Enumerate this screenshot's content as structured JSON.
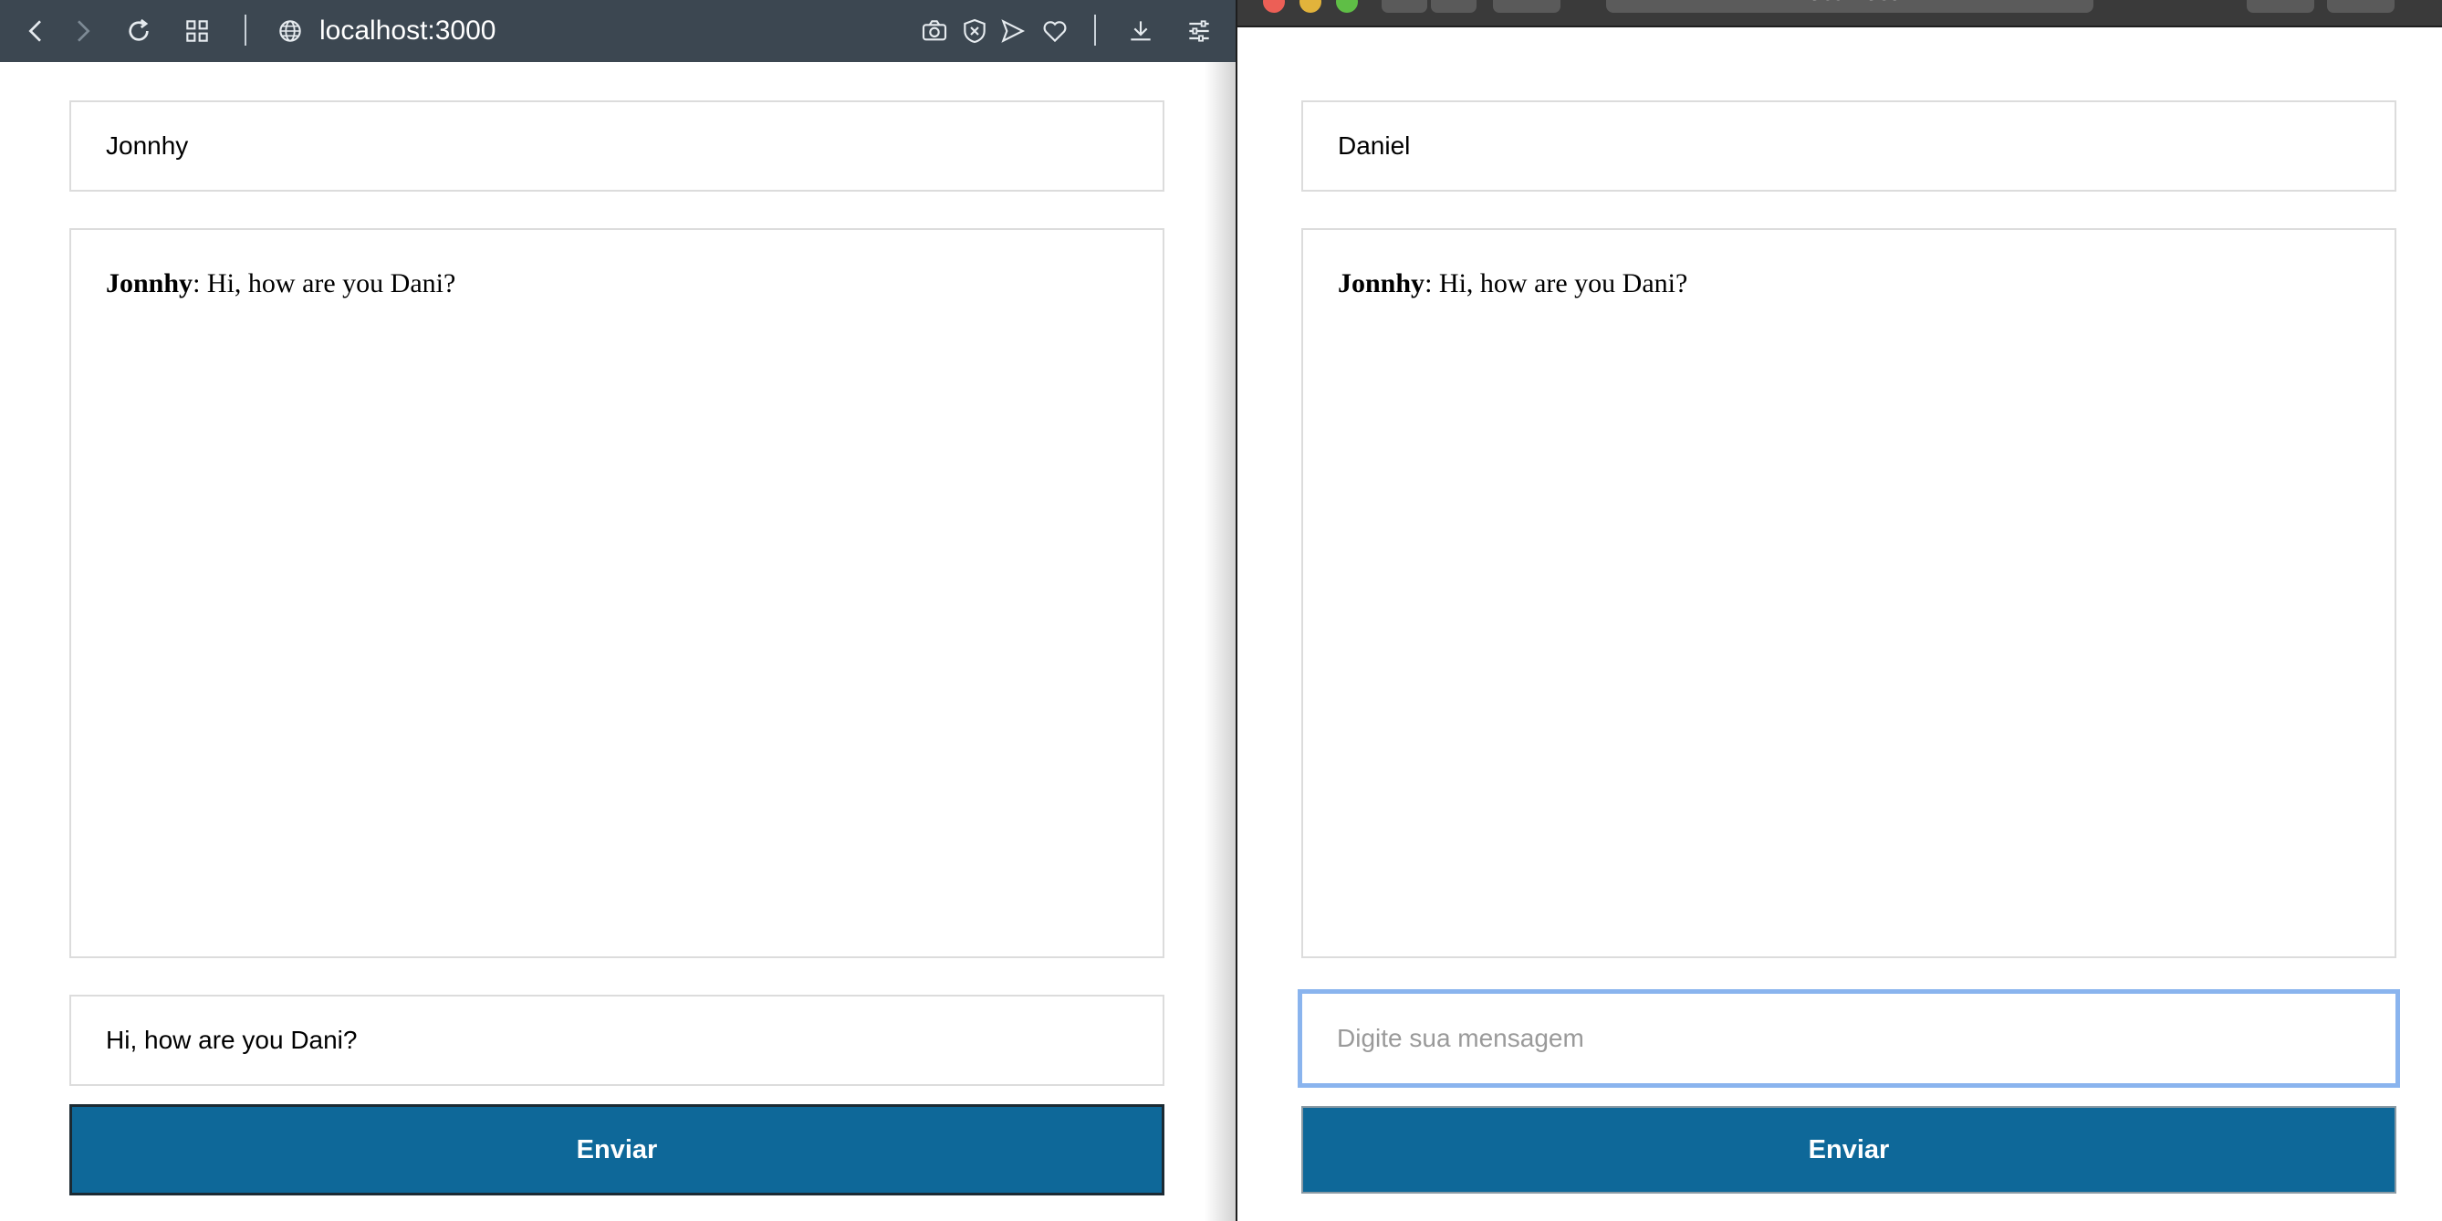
{
  "left_window": {
    "address": "localhost:3000",
    "icons": [
      "back-icon",
      "forward-icon",
      "reload-icon",
      "tabs-grid-icon",
      "globe-icon",
      "camera-icon",
      "shield-close-icon",
      "send-icon",
      "heart-icon",
      "download-icon",
      "settings-icon"
    ],
    "chat": {
      "name_value": "Jonnhy",
      "messages": [
        {
          "author": "Jonnhy",
          "text": ": Hi, how are you Dani?"
        }
      ],
      "message_input_value": "Hi, how are you Dani?",
      "send_label": "Enviar"
    }
  },
  "right_window": {
    "address": "localhost",
    "chat": {
      "name_value": "Daniel",
      "messages": [
        {
          "author": "Jonnhy",
          "text": ": Hi, how are you Dani?"
        }
      ],
      "message_input_placeholder": "Digite sua mensagem",
      "send_label": "Enviar"
    }
  },
  "colors": {
    "left_toolbar": "#3c4751",
    "send_button": "#0e6899",
    "focus_ring": "#8ab4ee"
  }
}
